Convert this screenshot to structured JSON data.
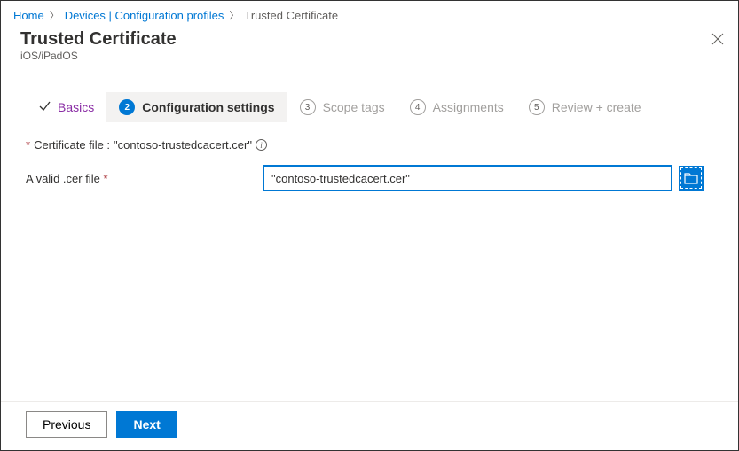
{
  "breadcrumb": {
    "items": [
      {
        "label": "Home"
      },
      {
        "label": "Devices | Configuration profiles"
      },
      {
        "label": "Trusted Certificate"
      }
    ]
  },
  "header": {
    "title": "Trusted Certificate",
    "subtitle": "iOS/iPadOS"
  },
  "steps": {
    "s1": {
      "label": "Basics"
    },
    "s2": {
      "num": "2",
      "label": "Configuration settings"
    },
    "s3": {
      "num": "3",
      "label": "Scope tags"
    },
    "s4": {
      "num": "4",
      "label": "Assignments"
    },
    "s5": {
      "num": "5",
      "label": "Review + create"
    }
  },
  "cert": {
    "label_prefix": "Certificate file : ",
    "filename": "\"contoso-trustedcacert.cer\"",
    "required_marker": "*"
  },
  "field": {
    "label": "A valid .cer file",
    "required_marker": "*",
    "value": "\"contoso-trustedcacert.cer\""
  },
  "footer": {
    "previous": "Previous",
    "next": "Next"
  }
}
